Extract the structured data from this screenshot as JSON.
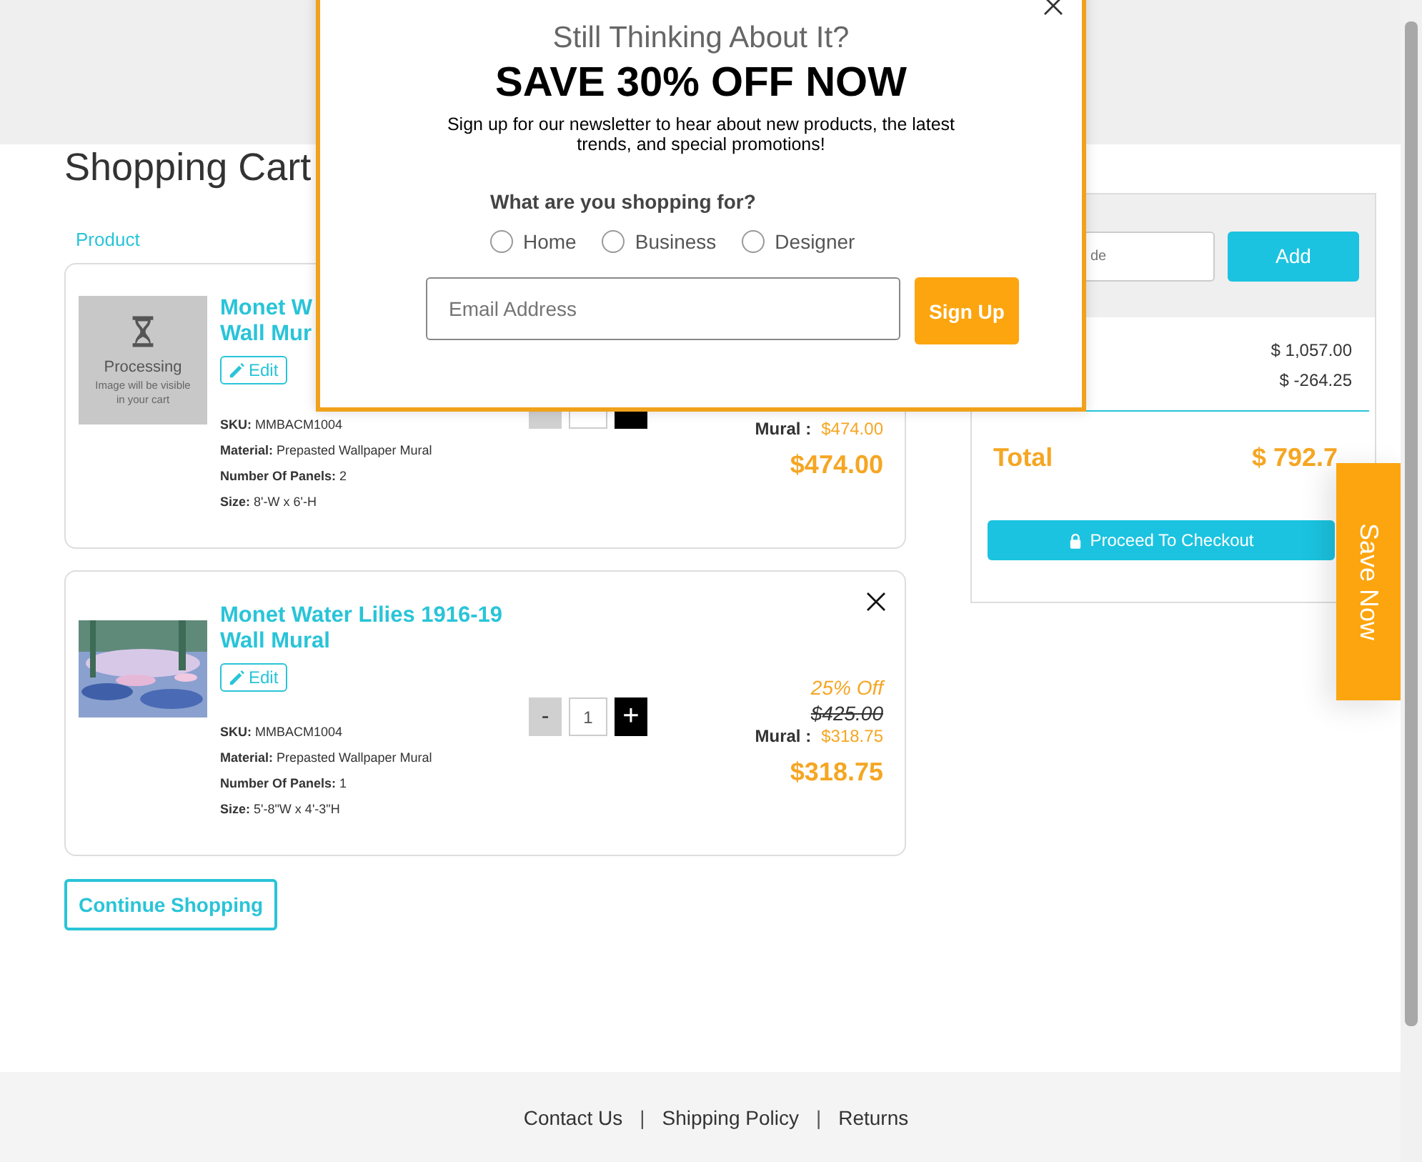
{
  "page_title": "Shopping Cart",
  "column_header": "Product",
  "items": [
    {
      "image": {
        "kind": "processing",
        "caption": "Processing",
        "note": "Image will be visible in your cart"
      },
      "title_lines": [
        "Monet W",
        "Wall Mur"
      ],
      "edit": "Edit",
      "specs": [
        {
          "label": "SKU:",
          "value": "MMBACM1004"
        },
        {
          "label": "Material:",
          "value": "Prepasted Wallpaper Mural"
        },
        {
          "label": "Number Of Panels:",
          "value": "2"
        },
        {
          "label": "Size:",
          "value": "8'-W x 6'-H"
        }
      ],
      "price_label": "Mural :",
      "price": "$474.00",
      "total": "$474.00"
    },
    {
      "image": {
        "kind": "picture"
      },
      "title_lines": [
        "Monet Water Lilies 1916-19",
        "Wall Mural"
      ],
      "edit": "Edit",
      "specs": [
        {
          "label": "SKU:",
          "value": "MMBACM1004"
        },
        {
          "label": "Material:",
          "value": "Prepasted Wallpaper Mural"
        },
        {
          "label": "Number Of Panels:",
          "value": "1"
        },
        {
          "label": "Size:",
          "value": "5'-8\"W x 4'-3\"H"
        }
      ],
      "quantity": {
        "minus": "-",
        "value": "1",
        "plus": "+"
      },
      "removable": true,
      "discount": "25% Off",
      "old_price": "$425.00",
      "price_label": "Mural :",
      "price": "$318.75",
      "total": "$318.75"
    }
  ],
  "continue_button": "Continue Shopping",
  "summary": {
    "coupon_placeholder": "de",
    "add_button": "Add",
    "amounts": [
      "$ 1,057.00",
      "$ -264.25"
    ],
    "total_label": "Total",
    "total": "$ 792.7",
    "checkout_button": "Proceed To Checkout"
  },
  "popup": {
    "subtitle": "Still Thinking About It?",
    "headline": "SAVE 30% OFF NOW",
    "text": "Sign up for our newsletter to hear about new products, the latest trends, and special promotions!",
    "question": "What are you shopping for?",
    "options": [
      {
        "label": "Home",
        "selected": false
      },
      {
        "label": "Business",
        "selected": false
      },
      {
        "label": "Designer",
        "selected": false
      }
    ],
    "email_placeholder": "Email Address",
    "submit": "Sign Up"
  },
  "save_tab": "Save Now",
  "footer": [
    {
      "kind": "link",
      "text": "Contact Us"
    },
    {
      "kind": "separator",
      "text": "|"
    },
    {
      "kind": "link",
      "text": "Shipping Policy"
    },
    {
      "kind": "separator",
      "text": "|"
    },
    {
      "kind": "link",
      "text": "Returns"
    }
  ]
}
